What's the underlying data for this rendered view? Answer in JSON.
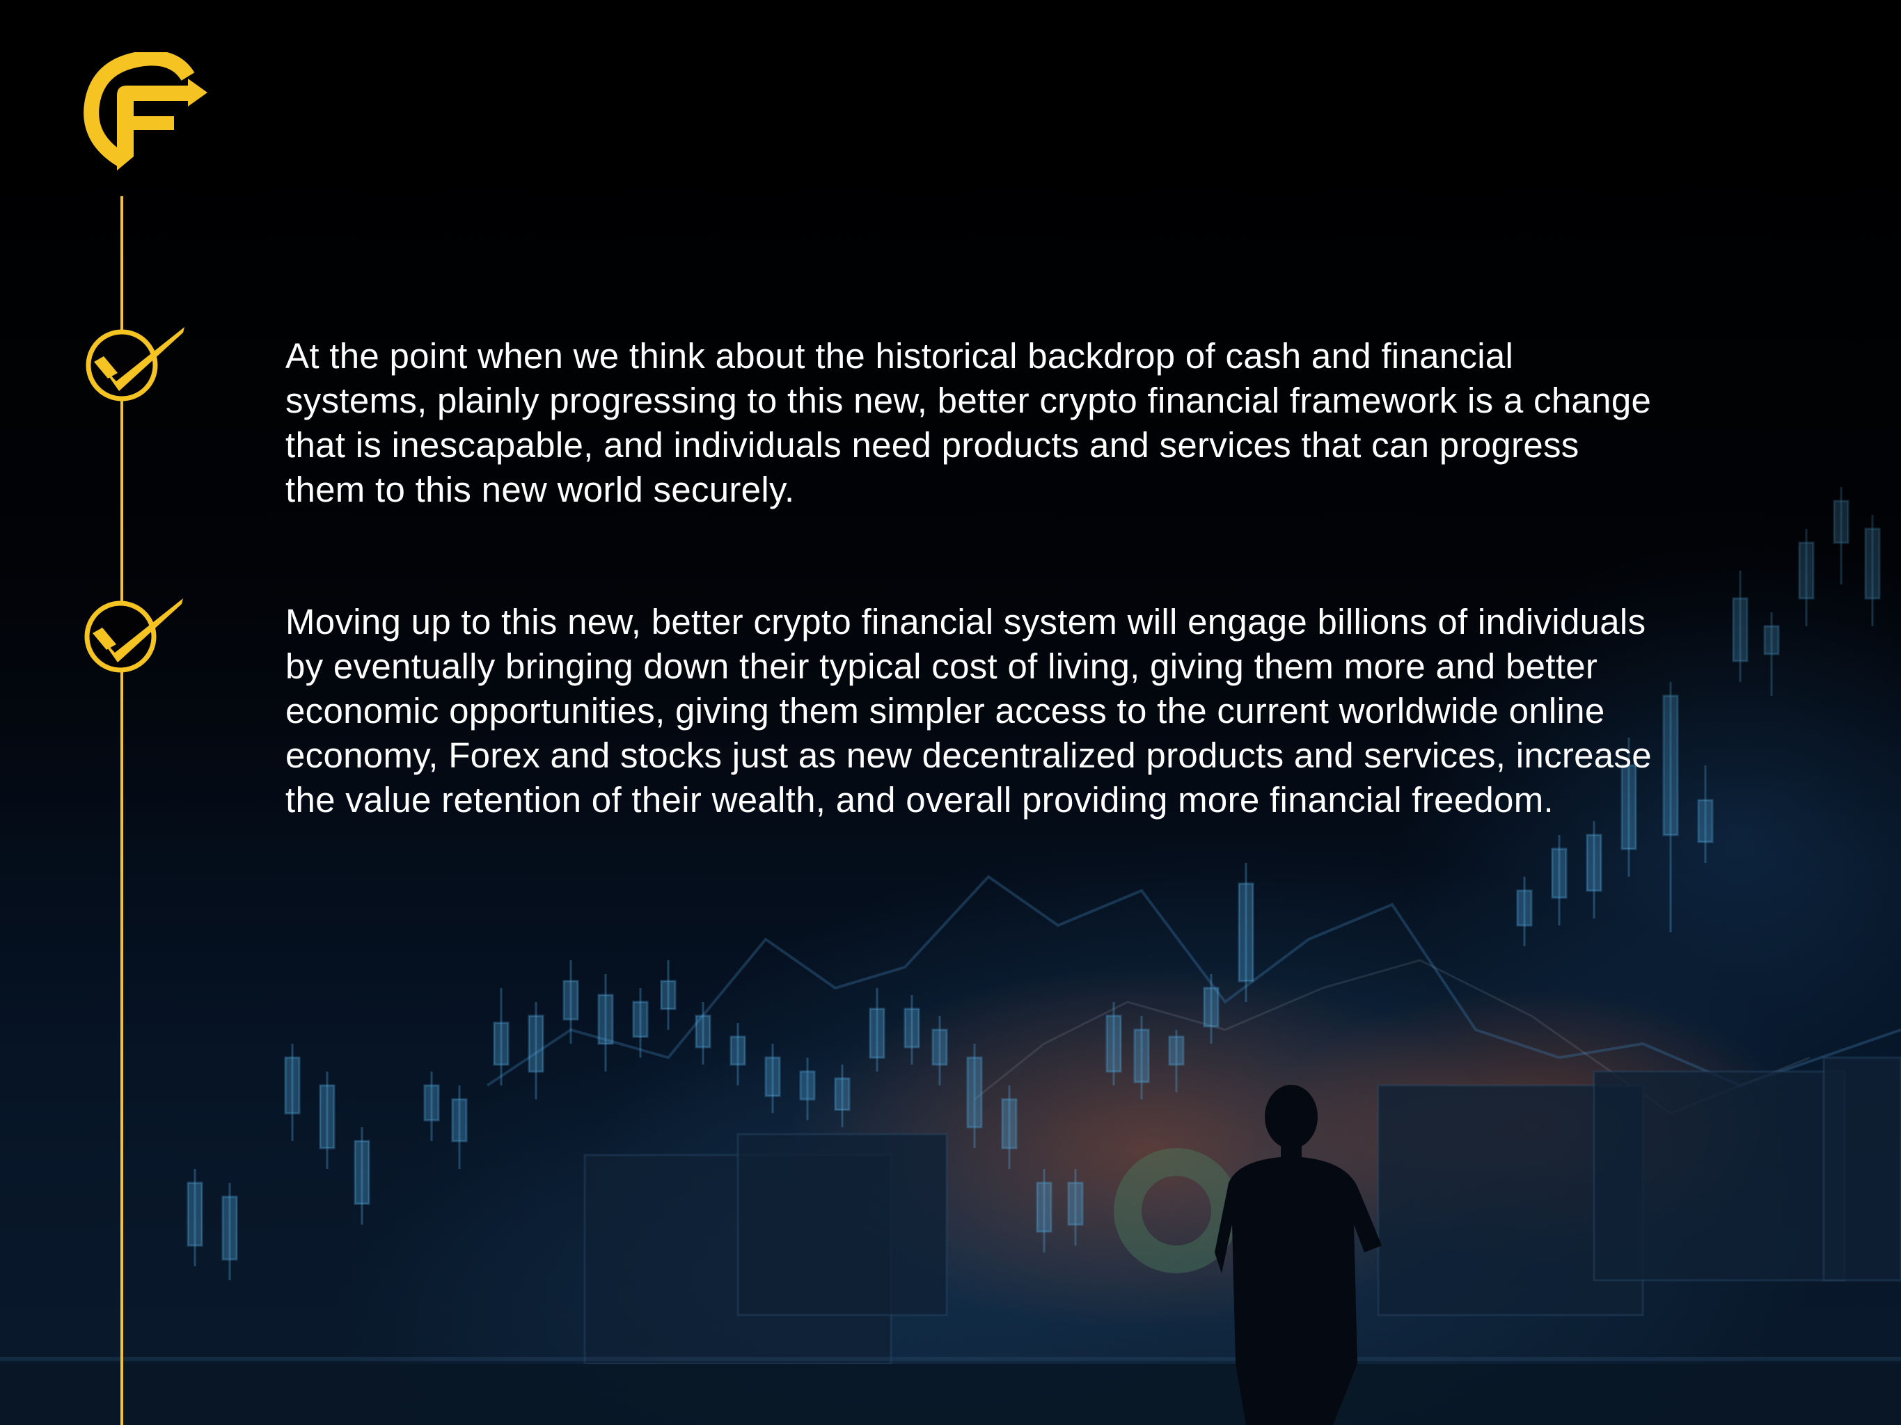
{
  "page": {
    "paragraphs": [
      "At the point when we think about the historical backdrop of cash and financial systems, plainly progressing to this new, better crypto financial framework is a change that is inescapable, and individuals need products and services that can progress them to this new world securely.",
      "Moving up to this new, better crypto financial system will engage billions of individuals by eventually bringing down their typical cost of living, giving them more and better economic opportunities, giving them simpler access to the current worldwide online economy, Forex and stocks just as new decentralized products and services, increase the value retention of their wealth, and overall providing more financial freedom."
    ]
  },
  "icons": {
    "logo": "brand-f-arrow-logo",
    "bullet": "check-circle-icon"
  },
  "colors": {
    "background": "#020205",
    "accent": "#f5c322",
    "text": "#ffffff"
  }
}
